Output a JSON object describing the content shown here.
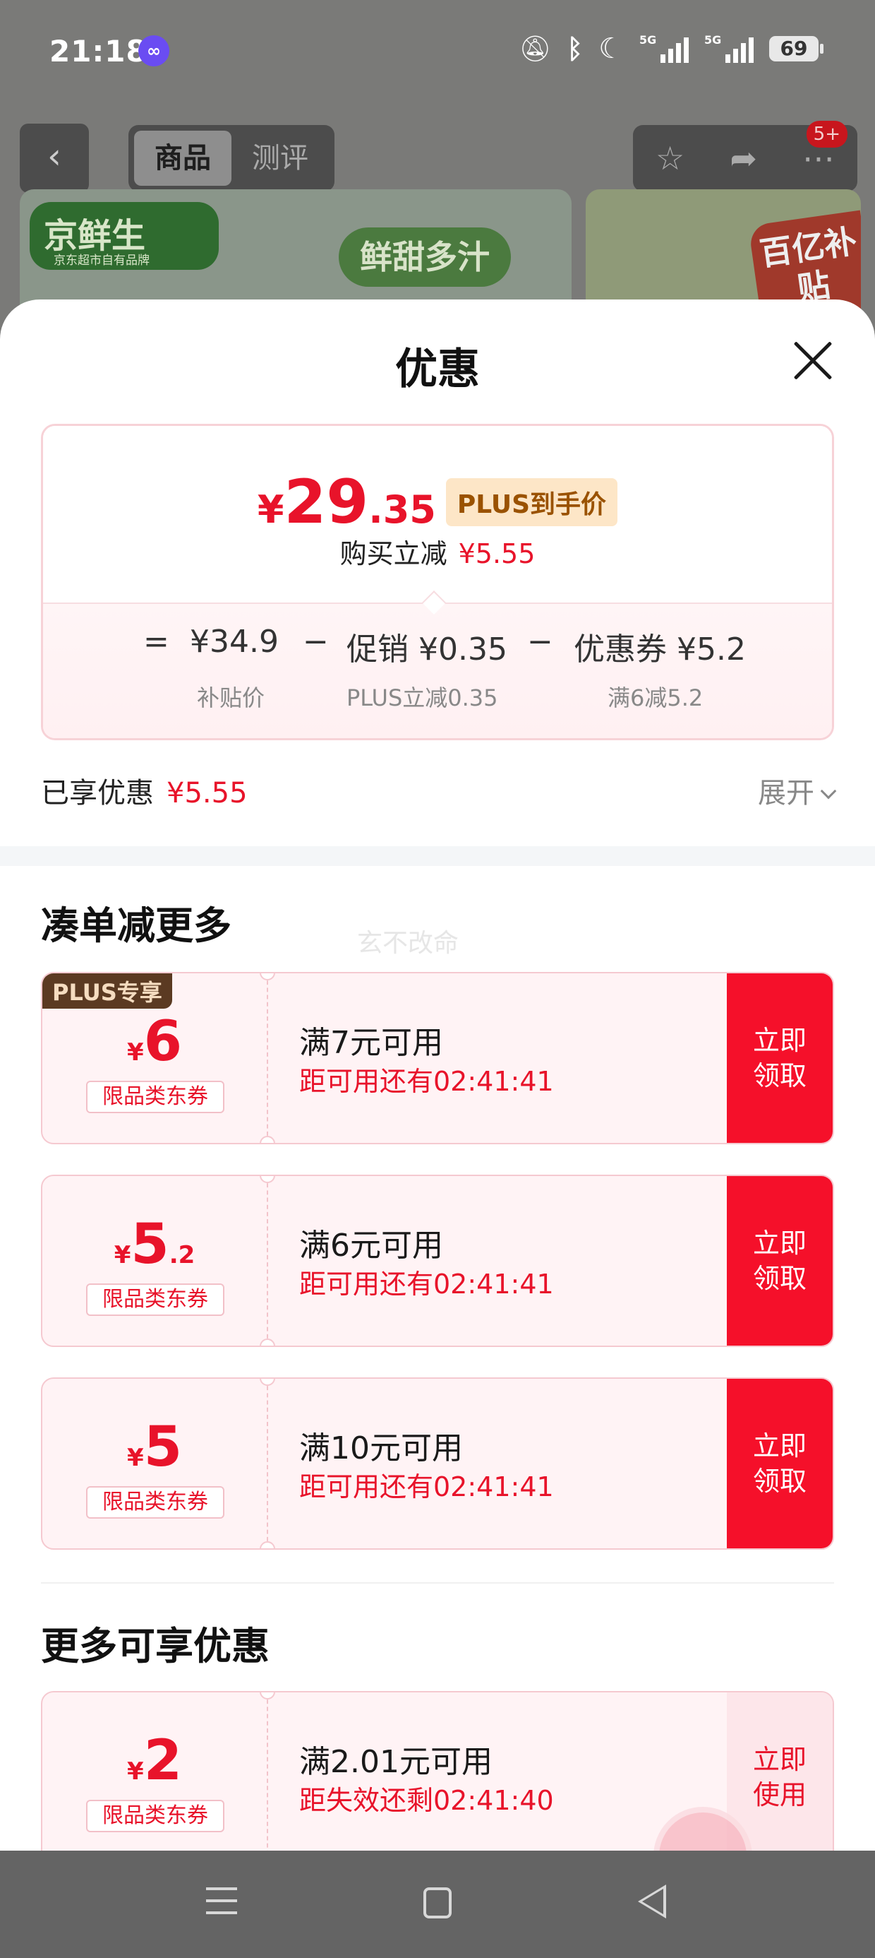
{
  "status_bar": {
    "time": "21:18",
    "battery": "69",
    "signal_1_label": "5G",
    "signal_2_label": "5G",
    "icons": [
      "app-link-icon",
      "mute-icon",
      "bluetooth-icon",
      "moon-icon",
      "signal-icon",
      "signal-icon",
      "battery-icon"
    ]
  },
  "product_header": {
    "tabs": [
      {
        "label": "商品",
        "active": true
      },
      {
        "label": "测评",
        "active": false
      }
    ],
    "notification_badge": "5+",
    "icons": [
      "back-icon",
      "star-icon",
      "share-icon",
      "more-icon"
    ]
  },
  "banner": {
    "brand_name": "京鲜生",
    "brand_sub": "京东超市自有品牌",
    "slogan": "鲜甜多汁",
    "subsidy_text": "百亿补贴"
  },
  "sheet": {
    "title": "优惠",
    "price": {
      "currency": "¥",
      "integer": "29",
      "decimal": ".35",
      "tag": "PLUS到手价",
      "instant_label": "购买立减",
      "instant_value": "¥5.55",
      "equals": "=",
      "minus": "−",
      "breakdown": [
        {
          "label": "¥34.9",
          "sub": "补贴价"
        },
        {
          "label": "促销 ¥0.35",
          "sub": "PLUS立减0.35"
        },
        {
          "label": "优惠券 ¥5.2",
          "sub": "满6减5.2"
        }
      ]
    },
    "saved": {
      "label": "已享优惠",
      "value": "¥5.55",
      "expand": "展开"
    },
    "section_more": "凑单减更多",
    "watermark": "玄不改命",
    "coupons": [
      {
        "plus_label": "PLUS专享",
        "currency": "¥",
        "amount": "6",
        "decimal": "",
        "type": "限品类东券",
        "condition": "满7元可用",
        "timer": "距可用还有02:41:41",
        "action": "立即领取"
      },
      {
        "currency": "¥",
        "amount": "5",
        "decimal": ".2",
        "type": "限品类东券",
        "condition": "满6元可用",
        "timer": "距可用还有02:41:41",
        "action": "立即领取"
      },
      {
        "currency": "¥",
        "amount": "5",
        "decimal": "",
        "type": "限品类东券",
        "condition": "满10元可用",
        "timer": "距可用还有02:41:41",
        "action": "立即领取"
      }
    ],
    "section_extra": "更多可享优惠",
    "extra_coupons": [
      {
        "currency": "¥",
        "amount": "2",
        "decimal": "",
        "type": "限品类东券",
        "condition": "满2.01元可用",
        "timer": "距失效还剩02:41:40",
        "action": "立即使用"
      }
    ]
  },
  "colors": {
    "accent_red": "#e8132a",
    "claim_button": "#f5102a",
    "plus_tag_bg": "#fde6c7",
    "coupon_bg": "#fff3f5"
  }
}
